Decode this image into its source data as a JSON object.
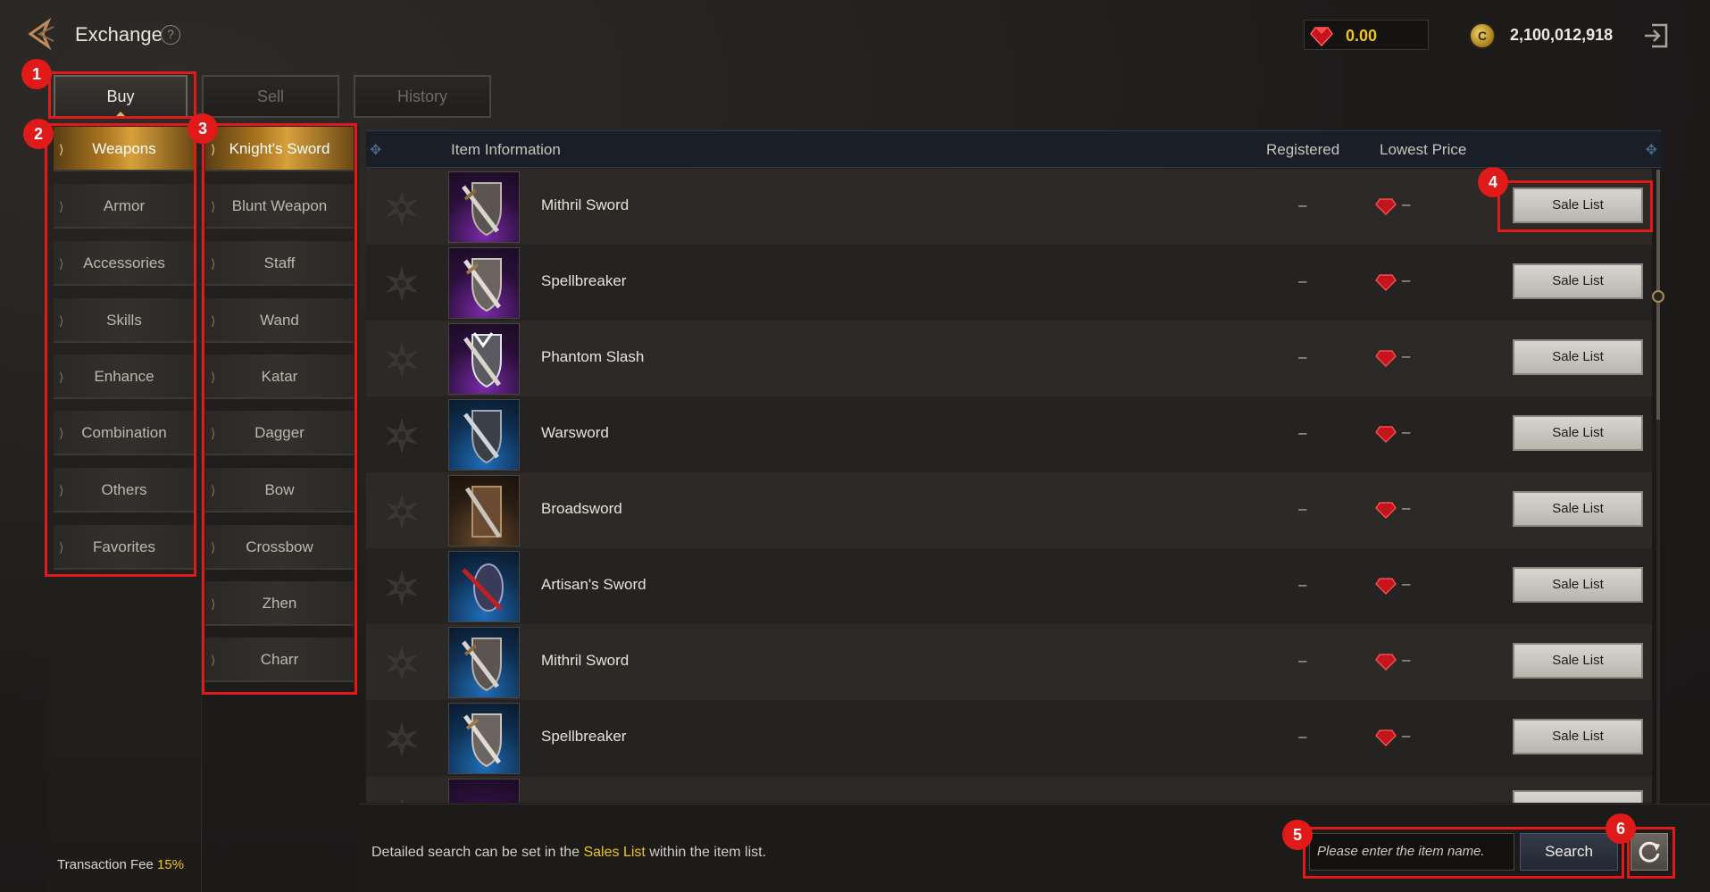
{
  "header": {
    "title": "Exchange",
    "help_icon": "?",
    "gem_balance": "0.00",
    "gold_balance": "2,100,012,918"
  },
  "tabs": [
    {
      "label": "Buy",
      "active": true
    },
    {
      "label": "Sell",
      "active": false
    },
    {
      "label": "History",
      "active": false
    }
  ],
  "categories": [
    "Weapons",
    "Armor",
    "Accessories",
    "Skills",
    "Enhance",
    "Combination",
    "Others",
    "Favorites"
  ],
  "subcategories": [
    "Knight's Sword",
    "Blunt Weapon",
    "Staff",
    "Wand",
    "Katar",
    "Dagger",
    "Bow",
    "Crossbow",
    "Zhen",
    "Charr"
  ],
  "fee": {
    "label": "Transaction Fee",
    "value": "15%"
  },
  "table": {
    "headers": {
      "info": "Item Information",
      "registered": "Registered",
      "lowest": "Lowest Price"
    },
    "rows": [
      {
        "name": "Mithril Sword",
        "registered": "–",
        "lowest": "–",
        "action": "Sale List",
        "grade": "purple"
      },
      {
        "name": "Spellbreaker",
        "registered": "–",
        "lowest": "–",
        "action": "Sale List",
        "grade": "purple"
      },
      {
        "name": "Phantom Slash",
        "registered": "–",
        "lowest": "–",
        "action": "Sale List",
        "grade": "purple"
      },
      {
        "name": "Warsword",
        "registered": "–",
        "lowest": "–",
        "action": "Sale List",
        "grade": "blue"
      },
      {
        "name": "Broadsword",
        "registered": "–",
        "lowest": "–",
        "action": "Sale List",
        "grade": "brown"
      },
      {
        "name": "Artisan's Sword",
        "registered": "–",
        "lowest": "–",
        "action": "Sale List",
        "grade": "blue"
      },
      {
        "name": "Mithril Sword",
        "registered": "–",
        "lowest": "–",
        "action": "Sale List",
        "grade": "blue"
      },
      {
        "name": "Spellbreaker",
        "registered": "–",
        "lowest": "–",
        "action": "Sale List",
        "grade": "blue"
      }
    ]
  },
  "bottom": {
    "hint_before": "Detailed search can be set in the ",
    "hint_link": "Sales List",
    "hint_after": " within the item list.",
    "search_placeholder": "Please enter the item name.",
    "search_label": "Search"
  },
  "annotations": [
    "1",
    "2",
    "3",
    "4",
    "5",
    "6"
  ],
  "colors": {
    "accent_gold": "#f0c419",
    "highlight_red": "#e01919",
    "selected_category": "#a8741e"
  }
}
